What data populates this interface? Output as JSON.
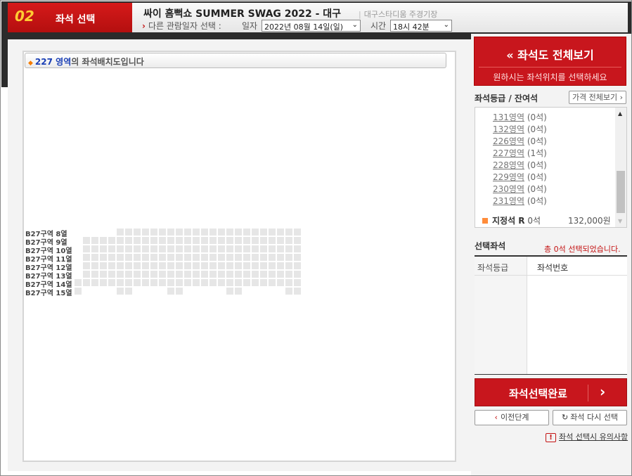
{
  "header": {
    "step_number": "02",
    "step_label": "좌석 선택",
    "title": "싸이 흠뻑쇼 SUMMER SWAG 2022 - 대구",
    "venue": "대구스타디움 주경기장",
    "other_date_label": "다른 관람일자 선택 :",
    "date_label": "일자",
    "date_value": "2022년 08월 14일(일)",
    "time_label": "시간",
    "time_value": "18시 42분"
  },
  "map": {
    "area_number": "227 영역",
    "area_suffix": "의 좌석배치도입니다",
    "rows": [
      "B27구역 8열",
      "B27구역 9열",
      "B27구역 10열",
      "B27구역 11열",
      "B27구역 12열",
      "B27구역 13열",
      "B27구역 14열",
      "B27구역 15열"
    ]
  },
  "sidebar": {
    "overview_button": "좌석도 전체보기",
    "overview_hint": "원하시는 좌석위치를 선택하세요",
    "grade_heading": "좌석등급 / 잔여석",
    "price_button": "가격 전체보기",
    "areas": [
      {
        "zone": "131영역",
        "count": "(0석)"
      },
      {
        "zone": "132영역",
        "count": "(0석)"
      },
      {
        "zone": "226영역",
        "count": "(0석)"
      },
      {
        "zone": "227영역",
        "count": "(1석)"
      },
      {
        "zone": "228영역",
        "count": "(0석)"
      },
      {
        "zone": "229영역",
        "count": "(0석)"
      },
      {
        "zone": "230영역",
        "count": "(0석)"
      },
      {
        "zone": "231영역",
        "count": "(0석)"
      }
    ],
    "grade_name": "지정석 R",
    "grade_count": "0석",
    "grade_price": "132,000원",
    "grade_color": "#ff8c3a",
    "selected_heading": "선택좌석",
    "selected_count": "총 0석 선택되었습니다.",
    "col_grade": "좌석등급",
    "col_number": "좌석번호",
    "complete_button": "좌석선택완료",
    "prev_button": "이전단계",
    "reselect_button": "좌석 다시 선택",
    "notice_link": "좌석 선택시 유의사항"
  },
  "colors": {
    "accent": "#c8161d",
    "seat": "#e6e6e6",
    "header_bg": "#2b2b2b"
  }
}
